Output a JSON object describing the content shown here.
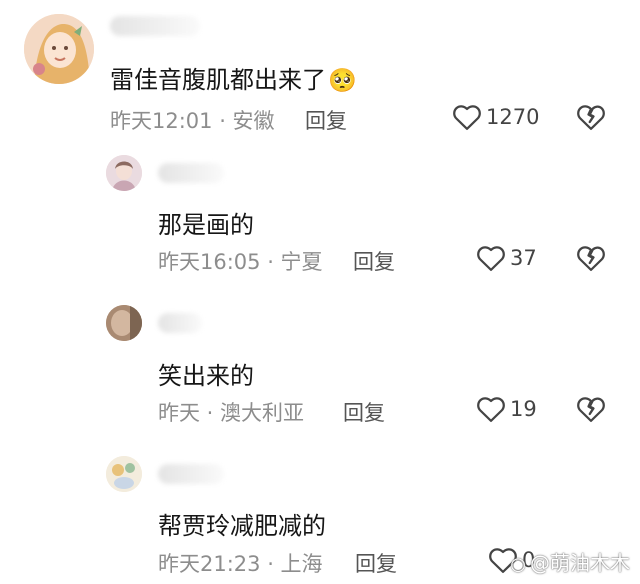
{
  "comments": [
    {
      "text": "雷佳音腹肌都出来了",
      "emoji": "🥺",
      "meta": "昨天12:01 · 安徽",
      "reply_label": "回复",
      "likes": "1270"
    },
    {
      "text": "那是画的",
      "meta": "昨天16:05 · 宁夏",
      "reply_label": "回复",
      "likes": "37"
    },
    {
      "text": "笑出来的",
      "meta": "昨天 · 澳大利亚",
      "reply_label": "回复",
      "likes": "19"
    },
    {
      "text": "帮贾玲减肥减的",
      "meta": "昨天21:23 · 上海",
      "reply_label": "回复",
      "likes": "0"
    }
  ],
  "watermark": {
    "icon": "weibo-icon",
    "text": "@萌油木木"
  },
  "colors": {
    "text": "#161616",
    "meta": "#8d8d8d",
    "icon": "#444444"
  }
}
